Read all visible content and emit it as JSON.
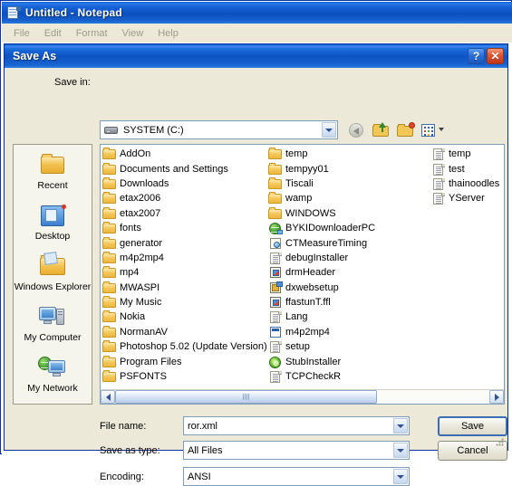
{
  "notepad": {
    "title": "Untitled - Notepad",
    "icon": "notepad-icon",
    "menu": [
      "File",
      "Edit",
      "Format",
      "View",
      "Help"
    ]
  },
  "dialog": {
    "title": "Save As",
    "help_button": "?",
    "close_button": "✕",
    "save_in_label": "Save in:",
    "save_in_value": "SYSTEM (C:)",
    "toolbar": [
      {
        "name": "back-button",
        "label": "Back"
      },
      {
        "name": "up-one-level-button",
        "label": "Up One Level"
      },
      {
        "name": "create-new-folder-button",
        "label": "Create New Folder"
      },
      {
        "name": "views-button",
        "label": "Views"
      }
    ],
    "places": [
      {
        "label": "Recent",
        "icon": "recent-folder-icon"
      },
      {
        "label": "Desktop",
        "icon": "desktop-icon"
      },
      {
        "label": "Windows Explorer",
        "icon": "windows-explorer-icon"
      },
      {
        "label": "My Computer",
        "icon": "my-computer-icon"
      },
      {
        "label": "My Network",
        "icon": "my-network-icon"
      }
    ],
    "files": {
      "column1": [
        {
          "name": "AddOn",
          "icon": "folder-icon"
        },
        {
          "name": "Documents and Settings",
          "icon": "folder-icon"
        },
        {
          "name": "Downloads",
          "icon": "folder-icon"
        },
        {
          "name": "etax2006",
          "icon": "folder-icon"
        },
        {
          "name": "etax2007",
          "icon": "folder-icon"
        },
        {
          "name": "fonts",
          "icon": "folder-icon"
        },
        {
          "name": "generator",
          "icon": "folder-icon"
        },
        {
          "name": "m4p2mp4",
          "icon": "folder-icon"
        },
        {
          "name": "mp4",
          "icon": "folder-icon"
        },
        {
          "name": "MWASPI",
          "icon": "folder-icon"
        },
        {
          "name": "My Music",
          "icon": "folder-icon"
        },
        {
          "name": "Nokia",
          "icon": "folder-icon"
        },
        {
          "name": "NormanAV",
          "icon": "folder-icon"
        },
        {
          "name": "Photoshop 5.02 (Update Version)",
          "icon": "folder-icon"
        },
        {
          "name": "Program Files",
          "icon": "folder-icon"
        }
      ],
      "column2": [
        {
          "name": "PSFONTS",
          "icon": "folder-icon"
        },
        {
          "name": "temp",
          "icon": "folder-icon"
        },
        {
          "name": "tempyy01",
          "icon": "folder-icon"
        },
        {
          "name": "Tiscali",
          "icon": "folder-icon"
        },
        {
          "name": "wamp",
          "icon": "folder-icon"
        },
        {
          "name": "WINDOWS",
          "icon": "folder-icon"
        },
        {
          "name": "BYKIDownloaderPC",
          "icon": "globe-file-icon"
        },
        {
          "name": "CTMeasureTiming",
          "icon": "ct-file-icon"
        },
        {
          "name": "debugInstaller",
          "icon": "text-document-icon"
        },
        {
          "name": "drmHeader",
          "icon": "application-file-icon"
        },
        {
          "name": "dxwebsetup",
          "icon": "installer-file-icon"
        },
        {
          "name": "ffastunT.ffl",
          "icon": "application-file-icon"
        },
        {
          "name": "Lang",
          "icon": "text-document-icon"
        },
        {
          "name": "m4p2mp4",
          "icon": "config-file-icon"
        },
        {
          "name": "setup",
          "icon": "text-document-icon"
        }
      ],
      "column3": [
        {
          "name": "StubInstaller",
          "icon": "green-orb-icon"
        },
        {
          "name": "TCPCheckR",
          "icon": "text-document-icon"
        },
        {
          "name": "temp",
          "icon": "text-document-icon"
        },
        {
          "name": "test",
          "icon": "text-document-icon"
        },
        {
          "name": "thainoodles",
          "icon": "text-document-icon"
        },
        {
          "name": "YServer",
          "icon": "text-document-icon"
        }
      ]
    },
    "form": {
      "file_name_label": "File name:",
      "file_name_value": "ror.xml",
      "save_as_type_label": "Save as type:",
      "save_as_type_value": "All Files",
      "encoding_label": "Encoding:",
      "encoding_value": "ANSI"
    },
    "buttons": {
      "save": "Save",
      "cancel": "Cancel"
    },
    "scrollbar": {
      "thumb_left_percent": 0,
      "thumb_width_percent": 70
    }
  },
  "colors": {
    "title_blue": "#0c4fbe",
    "dialog_face": "#ece9d8",
    "list_background": "#ffffff",
    "close_red": "#c4341a",
    "default_button_border": "#3c6cb4"
  }
}
